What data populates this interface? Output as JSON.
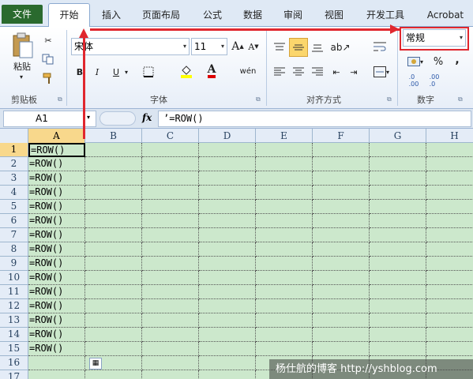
{
  "tabs": [
    "文件",
    "开始",
    "插入",
    "页面布局",
    "公式",
    "数据",
    "审阅",
    "视图",
    "开发工具",
    "Acrobat"
  ],
  "active_tab": "开始",
  "ribbon": {
    "clipboard": {
      "paste_label": "粘贴",
      "group_label": "剪贴板"
    },
    "font": {
      "font_name": "宋体",
      "font_size": "11",
      "group_label": "字体",
      "bold": "B",
      "italic": "I",
      "underline": "U",
      "grow": "A",
      "shrink": "A",
      "fontcolor": "A",
      "phonetic": "wén"
    },
    "alignment": {
      "group_label": "对齐方式"
    },
    "number": {
      "format": "常规",
      "group_label": "数字",
      "percent": "%",
      "comma": ",",
      "inc_decimal": ".0\n.00",
      "dec_decimal": ".00\n.0"
    }
  },
  "formula_bar": {
    "name_box": "A1",
    "fx": "fx",
    "content": "’=ROW()"
  },
  "columns": [
    "A",
    "B",
    "C",
    "D",
    "E",
    "F",
    "G",
    "H"
  ],
  "rows": [
    "1",
    "2",
    "3",
    "4",
    "5",
    "6",
    "7",
    "8",
    "9",
    "10",
    "11",
    "12",
    "13",
    "14",
    "15",
    "16",
    "17"
  ],
  "cells_A": [
    "=ROW()",
    "=ROW()",
    "=ROW()",
    "=ROW()",
    "=ROW()",
    "=ROW()",
    "=ROW()",
    "=ROW()",
    "=ROW()",
    "=ROW()",
    "=ROW()",
    "=ROW()",
    "=ROW()",
    "=ROW()",
    "=ROW()",
    "",
    ""
  ],
  "watermark": "杨仕航的博客 http://yshblog.com",
  "colors": {
    "file_tab": "#2a6a2e",
    "sheet_bg": "#cce8cc",
    "annotation": "#e0272e",
    "selected_header": "#f8d88c"
  }
}
